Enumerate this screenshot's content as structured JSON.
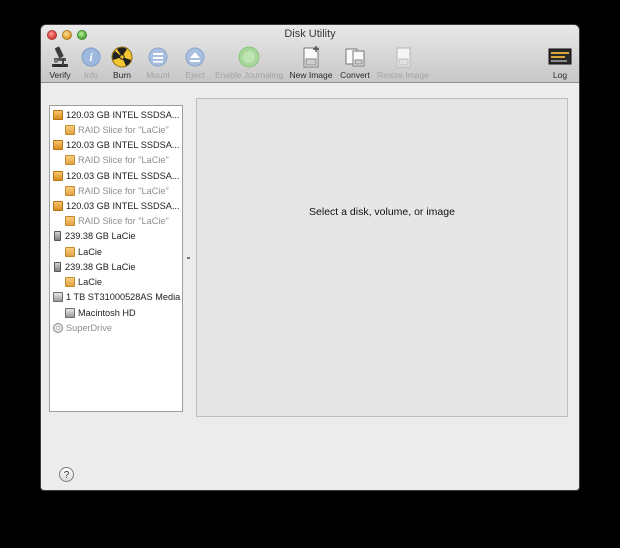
{
  "window": {
    "title": "Disk Utility"
  },
  "toolbar": {
    "verify": "Verify",
    "info": "Info",
    "burn": "Burn",
    "mount": "Mount",
    "eject": "Eject",
    "enable_journaling": "Enable Journaling",
    "new_image": "New Image",
    "convert": "Convert",
    "resize_image": "Resize Image",
    "log": "Log",
    "log_icon_text": "WARNING\nERROR"
  },
  "sidebar": {
    "items": [
      {
        "label": "120.03 GB INTEL SSDSA...",
        "icon": "internal-disk-icon"
      },
      {
        "label": "RAID Slice for \"LaCie\"",
        "icon": "raid-slice-icon"
      },
      {
        "label": "120.03 GB INTEL SSDSA...",
        "icon": "internal-disk-icon"
      },
      {
        "label": "RAID Slice for \"LaCie\"",
        "icon": "raid-slice-icon"
      },
      {
        "label": "120.03 GB INTEL SSDSA...",
        "icon": "internal-disk-icon"
      },
      {
        "label": "RAID Slice for \"LaCie\"",
        "icon": "raid-slice-icon"
      },
      {
        "label": "120.03 GB INTEL SSDSA...",
        "icon": "internal-disk-icon"
      },
      {
        "label": "RAID Slice for \"LaCie\"",
        "icon": "raid-slice-icon"
      },
      {
        "label": "239.38 GB LaCie",
        "icon": "external-disk-icon"
      },
      {
        "label": "LaCie",
        "icon": "volume-icon"
      },
      {
        "label": "239.38 GB LaCie",
        "icon": "external-disk-icon"
      },
      {
        "label": "LaCie",
        "icon": "volume-icon"
      },
      {
        "label": "1 TB ST31000528AS Media",
        "icon": "hard-disk-icon"
      },
      {
        "label": "Macintosh HD",
        "icon": "hard-disk-icon"
      },
      {
        "label": "SuperDrive",
        "icon": "optical-drive-icon"
      }
    ]
  },
  "main": {
    "message": "Select a disk, volume, or image"
  },
  "help": {
    "label": "?"
  }
}
